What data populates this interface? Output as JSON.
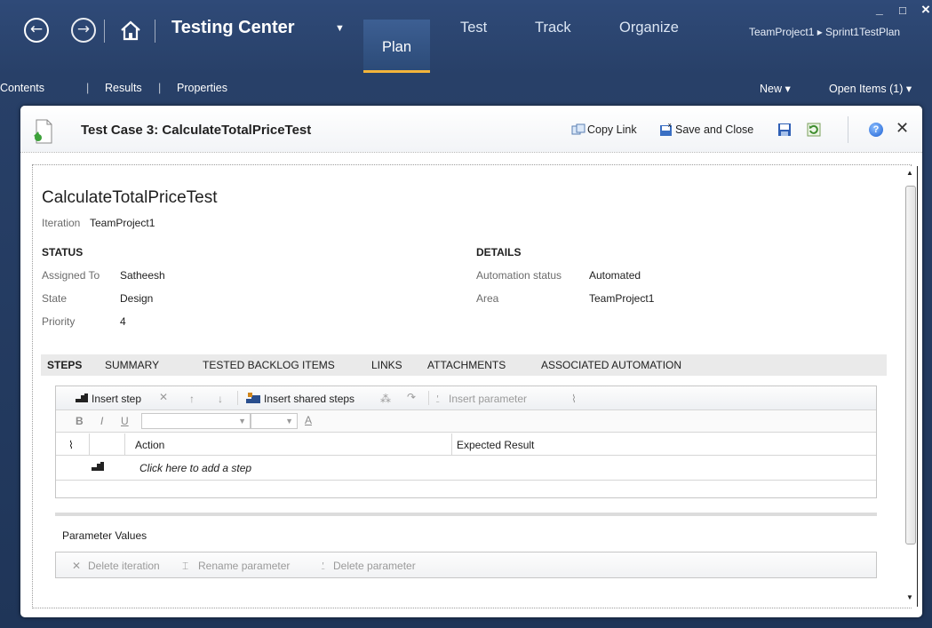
{
  "window": {
    "app_title": "Testing Center",
    "main_tabs": [
      {
        "label": "Plan",
        "active": true
      },
      {
        "label": "Test",
        "active": false
      },
      {
        "label": "Track",
        "active": false
      },
      {
        "label": "Organize",
        "active": false
      }
    ],
    "breadcrumb": "TeamProject1 ▸ Sprint1TestPlan",
    "minimize": "_",
    "maximize": "□",
    "close": "×"
  },
  "subnav": {
    "contents": "Contents",
    "results": "Results",
    "properties": "Properties",
    "new": "New ▾",
    "open_items": "Open Items (1) ▾"
  },
  "doc_header": {
    "title": "Test Case 3: CalculateTotalPriceTest",
    "copy_link": "Copy Link",
    "save_and_close": "Save and Close"
  },
  "work_item": {
    "name": "CalculateTotalPriceTest",
    "iteration_label": "Iteration",
    "iteration_value": "TeamProject1"
  },
  "status": {
    "heading": "STATUS",
    "assigned_to_label": "Assigned To",
    "assigned_to": "Satheesh",
    "state_label": "State",
    "state": "Design",
    "priority_label": "Priority",
    "priority": "4"
  },
  "details": {
    "heading": "DETAILS",
    "automation_status_label": "Automation status",
    "automation_status": "Automated",
    "area_label": "Area",
    "area": "TeamProject1"
  },
  "tabs": [
    "STEPS",
    "SUMMARY",
    "TESTED BACKLOG ITEMS",
    "LINKS",
    "ATTACHMENTS",
    "ASSOCIATED AUTOMATION"
  ],
  "steps_toolbar": {
    "insert_step": "Insert step",
    "insert_shared_steps": "Insert shared steps",
    "insert_parameter": "Insert parameter"
  },
  "format_toolbar": {
    "bold": "B",
    "italic": "I",
    "underline": "U",
    "font_color": "A"
  },
  "steps_grid": {
    "columns": [
      "Action",
      "Expected Result"
    ],
    "add_step_placeholder": "Click here to add a step"
  },
  "parameter_values": {
    "title": "Parameter Values",
    "delete_iteration": "Delete iteration",
    "rename_parameter": "Rename parameter",
    "delete_parameter": "Delete parameter"
  },
  "colors": {
    "title_bar_bg": "#2b4670",
    "active_tab_underline": "#f3b43b",
    "tab_strip_bg": "#eaeaea"
  }
}
